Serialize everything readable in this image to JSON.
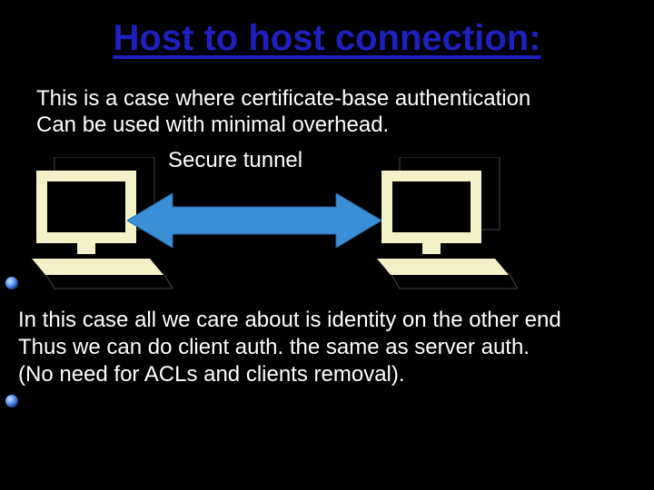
{
  "title": "Host to host connection:",
  "intro_line1": "This is a case where certificate-base authentication",
  "intro_line2": "Can be used with minimal overhead.",
  "tunnel_label": "Secure tunnel",
  "conclusion_line1": "In this case all we care about is identity on the other end",
  "conclusion_line2": "Thus we can do client auth.  the same as server auth.",
  "conclusion_line3": "(No need for ACLs and clients removal).",
  "icons": {
    "computer_left": "computer-icon",
    "computer_right": "computer-icon",
    "arrow": "double-arrow-icon"
  },
  "colors": {
    "title": "#2020c0",
    "text": "#ffffff",
    "computer_fill": "#f4f0c8",
    "arrow_fill": "#3b8fd6"
  }
}
